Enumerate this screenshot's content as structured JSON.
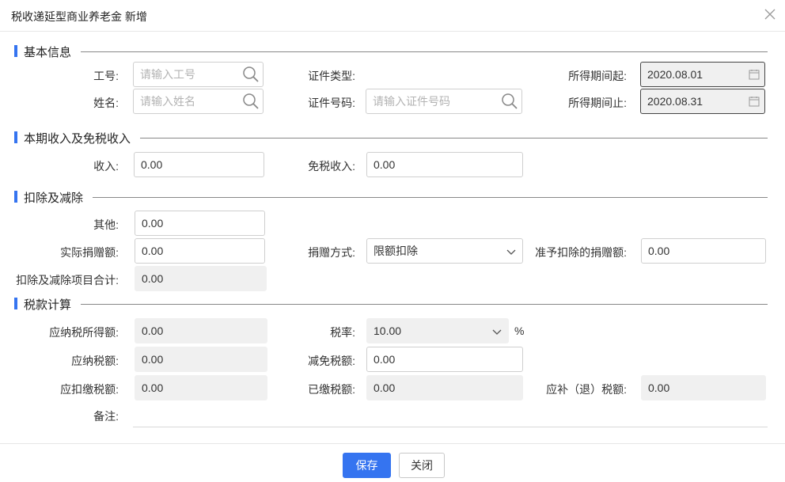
{
  "dialog": {
    "title": "税收递延型商业养老金 新增"
  },
  "sections": {
    "basic": "基本信息",
    "income": "本期收入及免税收入",
    "deduction": "扣除及减除",
    "tax": "税款计算"
  },
  "basic": {
    "emp_no_label": "工号:",
    "emp_no_placeholder": "请输入工号",
    "name_label": "姓名:",
    "name_placeholder": "请输入姓名",
    "id_type_label": "证件类型:",
    "id_type_value": "",
    "id_no_label": "证件号码:",
    "id_no_placeholder": "请输入证件号码",
    "period_start_label": "所得期间起:",
    "period_start_value": "2020.08.01",
    "period_end_label": "所得期间止:",
    "period_end_value": "2020.08.31"
  },
  "income": {
    "income_label": "收入:",
    "income_value": "0.00",
    "exempt_label": "免税收入:",
    "exempt_value": "0.00"
  },
  "deduction": {
    "other_label": "其他:",
    "other_value": "0.00",
    "donation_label": "实际捐赠额:",
    "donation_value": "0.00",
    "donation_method_label": "捐赠方式:",
    "donation_method_value": "限额扣除",
    "allowed_donation_label": "准予扣除的捐赠额:",
    "allowed_donation_value": "0.00",
    "total_label": "扣除及减除项目合计:",
    "total_value": "0.00"
  },
  "tax": {
    "taxable_income_label": "应纳税所得额:",
    "taxable_income_value": "0.00",
    "rate_label": "税率:",
    "rate_value": "10.00",
    "rate_unit": "%",
    "tax_payable_label": "应纳税额:",
    "tax_payable_value": "0.00",
    "tax_relief_label": "减免税额:",
    "tax_relief_value": "0.00",
    "withhold_label": "应扣缴税额:",
    "withhold_value": "0.00",
    "paid_label": "已缴税额:",
    "paid_value": "0.00",
    "refund_label": "应补（退）税额:",
    "refund_value": "0.00",
    "remark_label": "备注:",
    "remark_value": ""
  },
  "footer": {
    "save_label": "保存",
    "close_label": "关闭"
  },
  "colors": {
    "accent": "#3574f0",
    "readonly_bg": "#f0f0f0"
  },
  "icons": {
    "close": "close-icon",
    "search": "search-icon",
    "calendar": "calendar-icon",
    "dropdown": "chevron-down-icon"
  }
}
